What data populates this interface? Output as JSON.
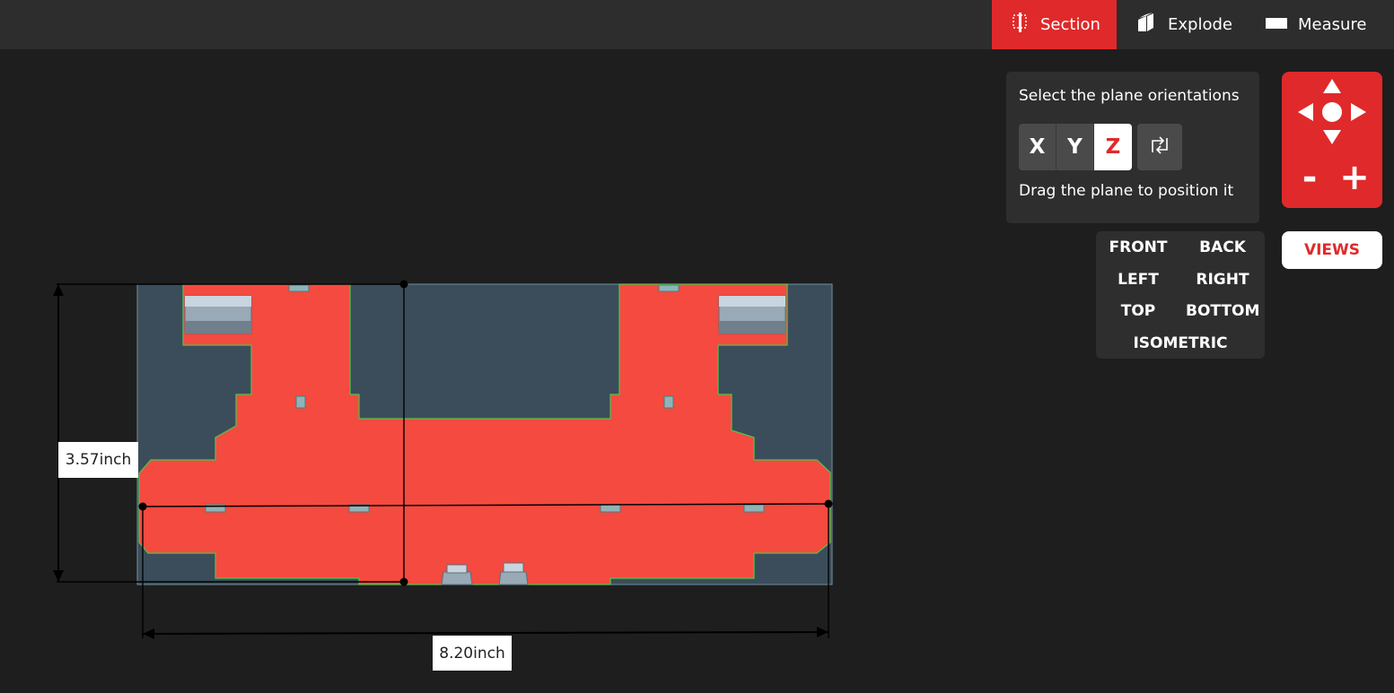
{
  "toolbar": {
    "section_label": "Section",
    "explode_label": "Explode",
    "measure_label": "Measure"
  },
  "plane_panel": {
    "title": "Select the plane orientations",
    "axes": [
      "X",
      "Y",
      "Z"
    ],
    "active_axis": "Z",
    "hint": "Drag the plane to position it"
  },
  "nav": {
    "zoom_out": "-",
    "zoom_in": "+"
  },
  "views": {
    "button_label": "VIEWS",
    "front": "FRONT",
    "back": "BACK",
    "left": "LEFT",
    "right": "RIGHT",
    "top": "TOP",
    "bottom": "BOTTOM",
    "isometric": "ISOMETRIC"
  },
  "measurements": {
    "height": "3.57inch",
    "width": "8.20inch"
  },
  "colors": {
    "accent": "#e0292a",
    "section_fill": "#f44a40",
    "plane": "#3b4d5a",
    "background": "#1e1e1e"
  },
  "icons": {
    "section": "section-icon",
    "explode": "explode-icon",
    "measure": "measure-icon",
    "flip": "flip-plane-icon"
  }
}
